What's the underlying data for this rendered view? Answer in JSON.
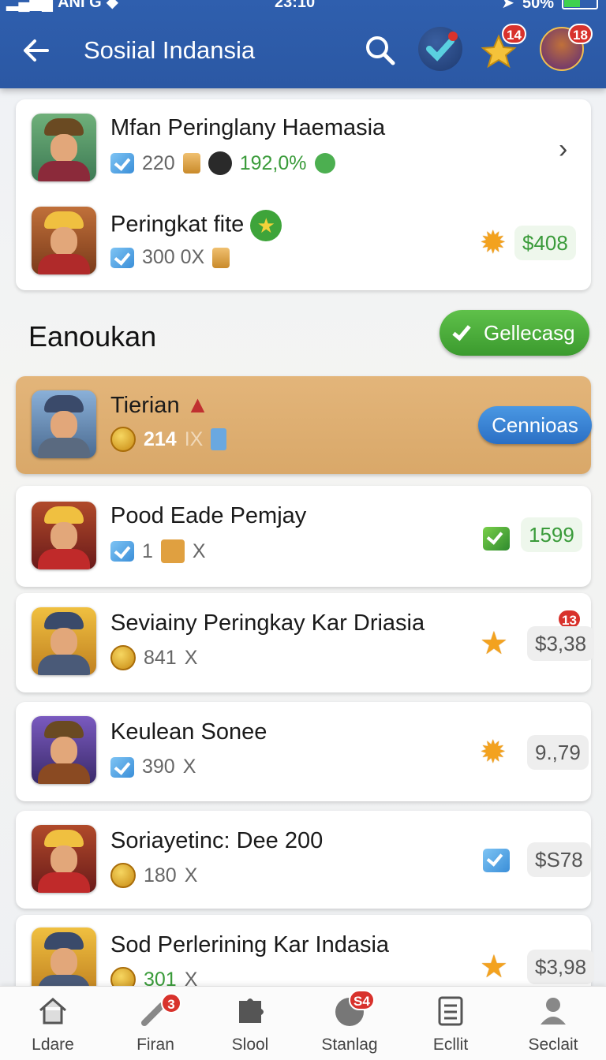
{
  "status_bar": {
    "carrier": "ANI G",
    "time": "23:10",
    "battery": "50%",
    "battery_level": 0.5
  },
  "header": {
    "title": "Sosiial Indansia",
    "notif_badge": "14",
    "avatar_badge": "18"
  },
  "top_card": {
    "items": [
      {
        "name": "Mfan Peringlany Haemasia",
        "count": "220",
        "percent": "192,0%"
      },
      {
        "name": "Peringkat fite",
        "count": "300 0X",
        "price": "$408"
      }
    ]
  },
  "section": {
    "title": "Eanoukan",
    "button_label": "Gellecasg"
  },
  "highlight": {
    "name": "Tierian",
    "count": "214",
    "suffix": "IX",
    "button_label": "Cennioas"
  },
  "list": [
    {
      "name": "Pood Eade Pemjay",
      "count": "1",
      "suffix": "X",
      "price": "1599",
      "price_style": "green"
    },
    {
      "name": "Seviainy Peringkay Kar Driasia",
      "count": "841",
      "suffix": "X",
      "price": "$3,38",
      "badge": "13"
    },
    {
      "name": "Keulean Sonee",
      "count": "390",
      "suffix": "X",
      "price": "9.,79"
    },
    {
      "name": "Soriayetinc: Dee 200",
      "count": "180",
      "suffix": "X",
      "price": "$S78"
    },
    {
      "name": "Sod Perlerining Kar Indasia",
      "count": "301",
      "suffix": "X",
      "price": "$3,98"
    }
  ],
  "bottom_nav": [
    {
      "label": "Ldare",
      "icon": "home-icon"
    },
    {
      "label": "Firan",
      "icon": "wrench-icon",
      "badge": "3"
    },
    {
      "label": "Slool",
      "icon": "puzzle-icon"
    },
    {
      "label": "Stanlag",
      "icon": "ball-icon",
      "badge": "S4"
    },
    {
      "label": "Ecllit",
      "icon": "clipboard-icon"
    },
    {
      "label": "Seclait",
      "icon": "profile-icon"
    }
  ]
}
